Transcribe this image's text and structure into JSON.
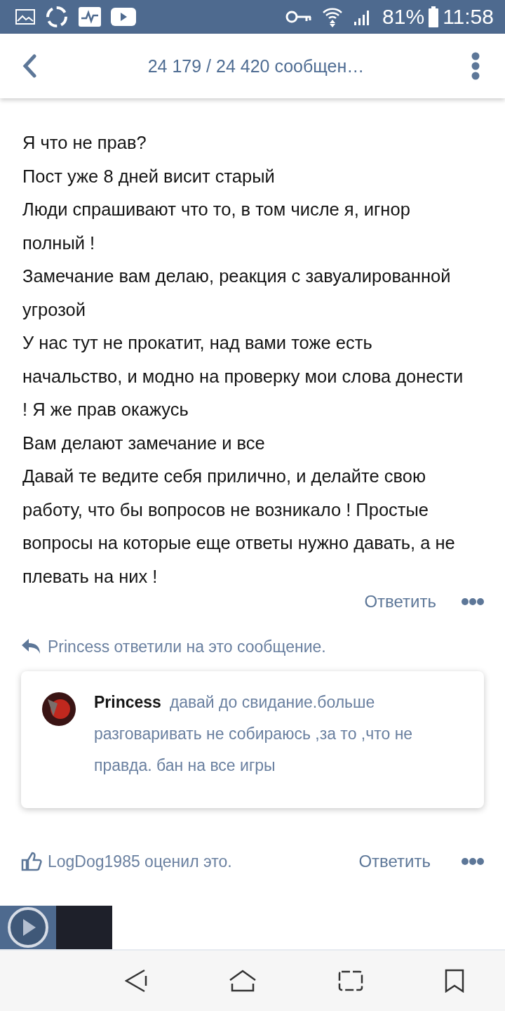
{
  "status_bar": {
    "battery": "81%",
    "time": "11:58"
  },
  "header": {
    "title": "24 179 / 24 420 сообщен…"
  },
  "post": {
    "paragraphs": [
      "Я что не прав?",
      "Пост уже 8 дней висит старый",
      "Люди спрашивают что то, в том числе я, игнор полный !",
      "Замечание вам делаю, реакция с завуалированной угрозой",
      "У нас тут не прокатит, над вами тоже есть начальство, и модно на проверку мои слова донести ! Я же прав окажусь",
      "Вам делают замечание и все",
      "Давай те ведите себя прилично, и делайте свою работу, что бы вопросов не возникало ! Простые вопросы на которые еще ответы нужно давать, а не плевать на них !"
    ],
    "reply_label": "Ответить"
  },
  "reply_notice": "Princess ответили на это сообщение.",
  "reply_popup": {
    "author": "Princess",
    "text": "давай до свидание.больше разговаривать не собираюсь ,за то ,что не правда. бан на все игры"
  },
  "next_post": {
    "reaction": "LogDog1985 оценил это.",
    "reply_label": "Ответить"
  }
}
